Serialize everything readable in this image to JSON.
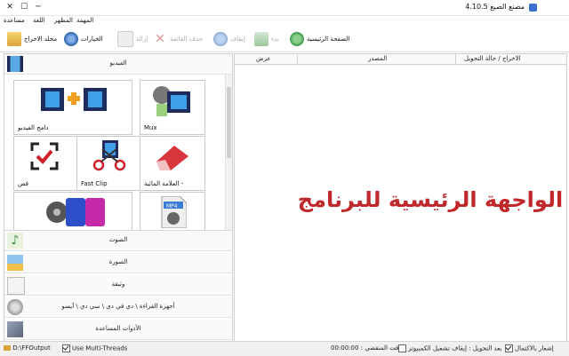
{
  "window": {
    "title": "مصنع الصيغ 4.10.5"
  },
  "menu": {
    "items": [
      "مساعدة",
      "اللغة",
      "المظهر",
      "المهمة"
    ]
  },
  "toolbar": {
    "home": "الصفحة الرئيسية",
    "start": "بدء",
    "stop": "إيقاف",
    "clear_list": "حذف القائمة",
    "remove": "إزالة",
    "options": "الخيارات",
    "output_folder": "مجلد الاخراج"
  },
  "categories": {
    "video": "الفيديو",
    "audio": "الصوت",
    "image": "الصورة",
    "document": "وثيقة",
    "rom": "أجهزة القراءة \\ دي في دي \\ سي دي \\ آيسو",
    "tools": "الأدوات المساعدة"
  },
  "tiles": {
    "video_joiner": "دامج الفيديو",
    "mux": "Mux",
    "crop": "قص",
    "fast_clip": "Fast Clip",
    "watermark": "العلامة المائية -",
    "devices": "",
    "mp4": ""
  },
  "list_header": {
    "output_status": "الاخراج / حالة التحويل",
    "source": "المصدر",
    "preview": "عرض"
  },
  "center_text": "الواجهة الرئيسية للبرنامج",
  "status": {
    "output_path": "D:\\FFOutput",
    "multithreads": "Use Multi-Threads",
    "elapsed": "00:00:00 : الوقت المنقضي",
    "shutdown": "بعد التحويل : إيقاف تشغيل الكمبيوتر",
    "notify": "إشعار بالاكتمال"
  }
}
